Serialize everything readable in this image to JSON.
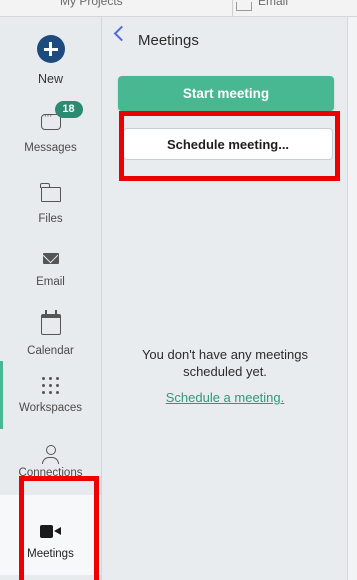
{
  "top_tabs": [
    {
      "label": "My Projects"
    },
    {
      "label": "Email"
    }
  ],
  "rail": {
    "items": [
      {
        "label": "New",
        "icon": "plus-circle-icon"
      },
      {
        "label": "Messages",
        "icon": "chat-icon",
        "badge": "18"
      },
      {
        "label": "Files",
        "icon": "folder-icon"
      },
      {
        "label": "Email",
        "icon": "envelope-icon"
      },
      {
        "label": "Calendar",
        "icon": "calendar-icon"
      },
      {
        "label": "Workspaces",
        "icon": "grid-dots-icon"
      },
      {
        "label": "Connections",
        "icon": "person-icon"
      },
      {
        "label": "Meetings",
        "icon": "video-camera-icon",
        "active": true
      }
    ]
  },
  "panel": {
    "title": "Meetings",
    "start_button": "Start meeting",
    "schedule_button": "Schedule meeting...",
    "empty_message": "You don't have any meetings scheduled yet.",
    "schedule_link": "Schedule a meeting."
  },
  "colors": {
    "accent_green": "#48b892",
    "link_green": "#2c9a78",
    "badge_green": "#2c8a72",
    "new_button_blue": "#1e4b7d",
    "back_chevron_blue": "#4c6cd9",
    "highlight_red": "#ee0000"
  }
}
